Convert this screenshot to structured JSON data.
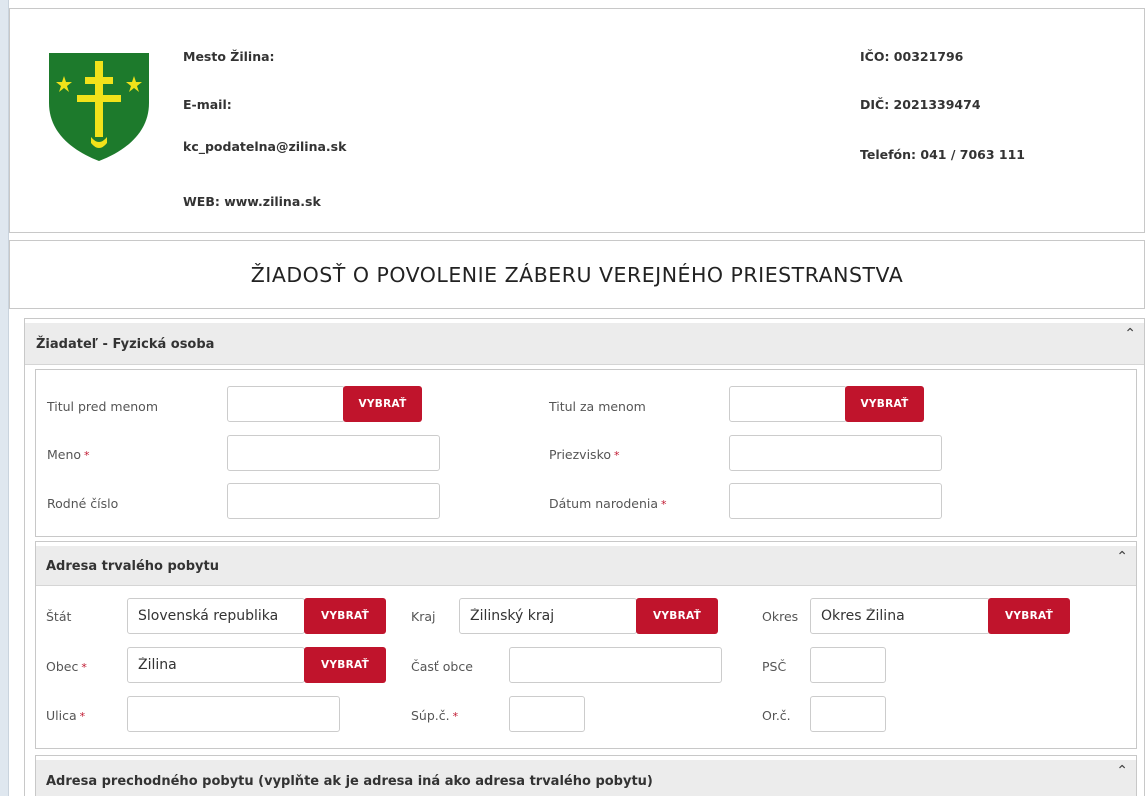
{
  "header": {
    "org_name": "Mesto Žilina:",
    "email_label": "E-mail:",
    "email": "kc_podatelna@zilina.sk",
    "web": "WEB: www.zilina.sk",
    "ico": "IČO: 00321796",
    "dic": "DIČ: 2021339474",
    "phone": "Telefón: 041 / 7063 111"
  },
  "title": "ŽIADOSŤ O POVOLENIE ZÁBERU VEREJNÉHO PRIESTRANSTVA",
  "applicant": {
    "section_title": "Žiadateľ - Fyzická osoba",
    "title_before_label": "Titul pred menom",
    "title_after_label": "Titul za menom",
    "first_name_label": "Meno",
    "last_name_label": "Priezvisko",
    "birth_number_label": "Rodné číslo",
    "birth_date_label": "Dátum narodenia",
    "required_mark": "*"
  },
  "permanent_address": {
    "section_title": "Adresa trvalého pobytu",
    "state_label": "Štát",
    "state_value": "Slovenská republika",
    "region_label": "Kraj",
    "region_value": "Žilinský kraj",
    "district_label": "Okres",
    "district_value": "Okres Žilina",
    "municipality_label": "Obec",
    "municipality_value": "Žilina",
    "part_label": "Časť obce",
    "zip_label": "PSČ",
    "street_label": "Ulica",
    "supc_label": "Súp.č.",
    "orc_label": "Or.č."
  },
  "temporary_address": {
    "section_title": "Adresa prechodného pobytu (vyplňte ak je adresa iná ako adresa trvalého pobytu)"
  },
  "buttons": {
    "choose": "VYBRAŤ"
  },
  "icons": {
    "collapse": "chevron-up-icon",
    "crest": "zilina-coat-of-arms"
  },
  "colors": {
    "accent": "#c0142c",
    "crest_green": "#1d7a2c",
    "crest_gold": "#f2e21a"
  }
}
